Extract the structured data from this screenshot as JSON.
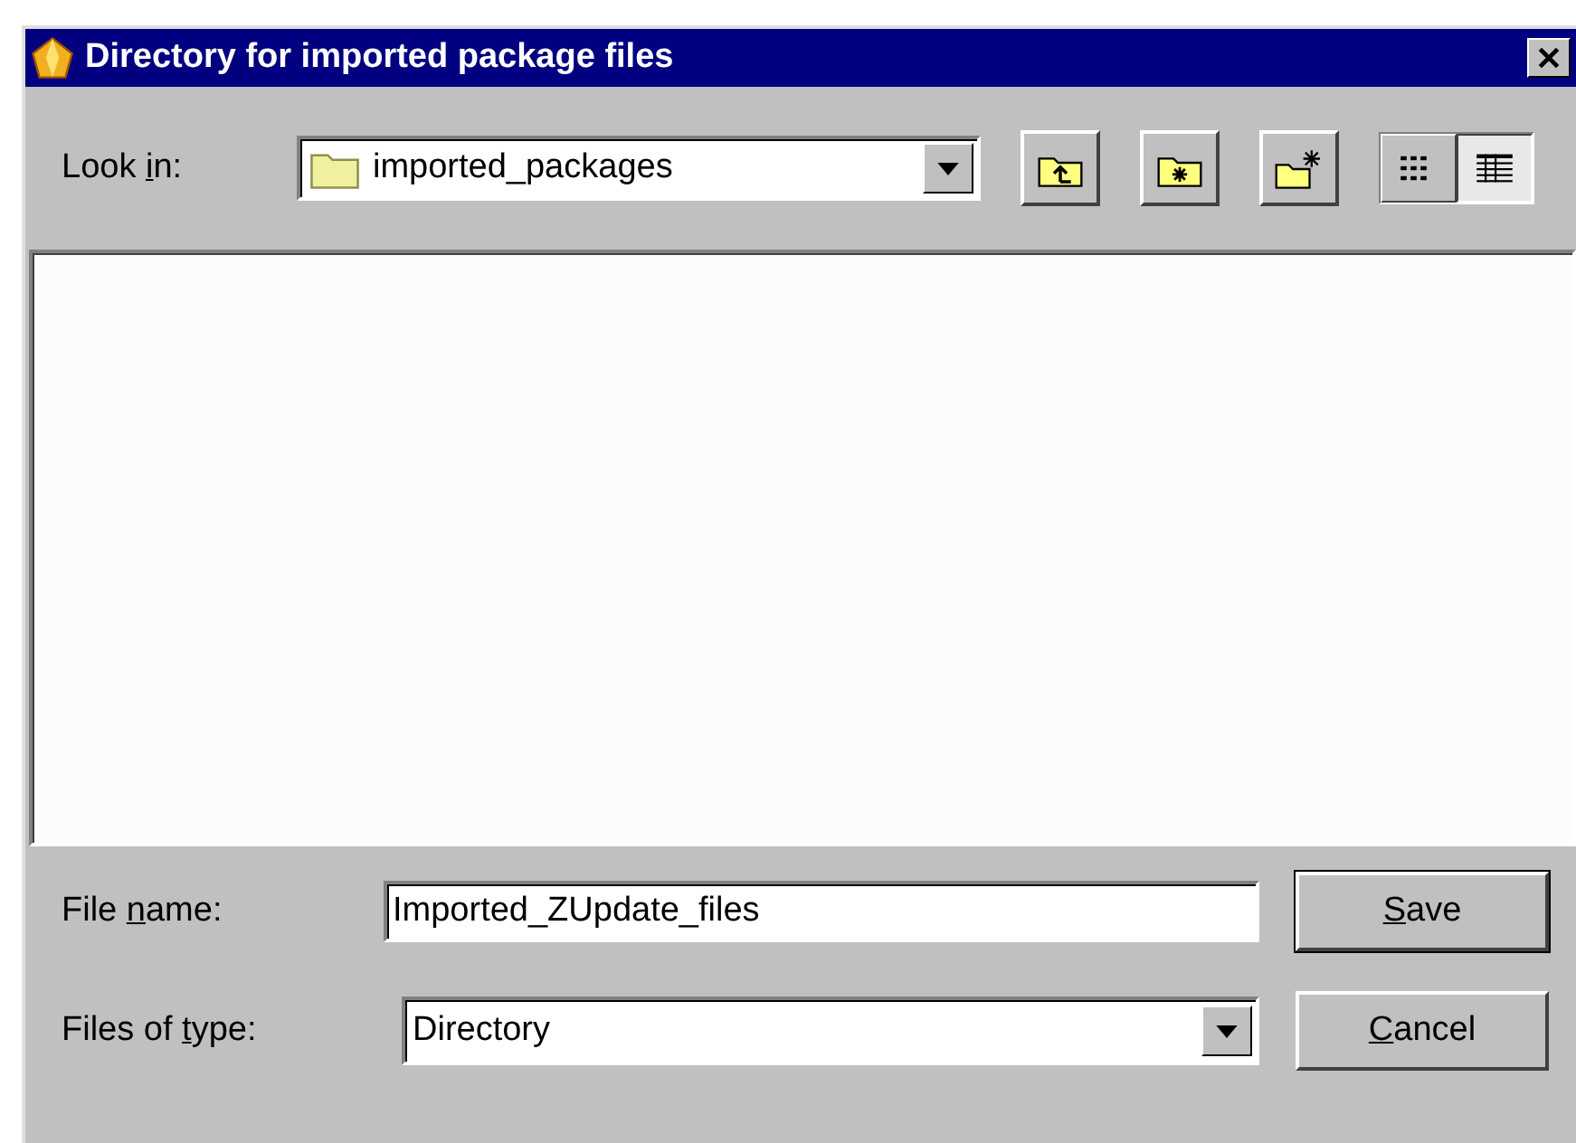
{
  "window": {
    "title": "Directory for imported package files"
  },
  "look_in": {
    "label": {
      "before": "Look ",
      "key": "i",
      "after": "n:"
    },
    "value": "imported_packages"
  },
  "toolbar": [
    {
      "kind": "up"
    },
    {
      "kind": "home"
    },
    {
      "kind": "new-folder"
    }
  ],
  "view_toggle": [
    {
      "kind": "list",
      "selected": false
    },
    {
      "kind": "details",
      "selected": true
    }
  ],
  "file_name": {
    "label": {
      "before": "File ",
      "key": "n",
      "after": "ame:"
    },
    "value": "Imported_ZUpdate_files"
  },
  "file_type": {
    "label": {
      "before": "Files of ",
      "key": "t",
      "after": "ype:"
    },
    "value": "Directory"
  },
  "buttons": [
    {
      "label": {
        "key": "S",
        "after": "ave"
      },
      "default": true
    },
    {
      "label": {
        "key": "C",
        "after": "ancel"
      },
      "default": false
    }
  ]
}
